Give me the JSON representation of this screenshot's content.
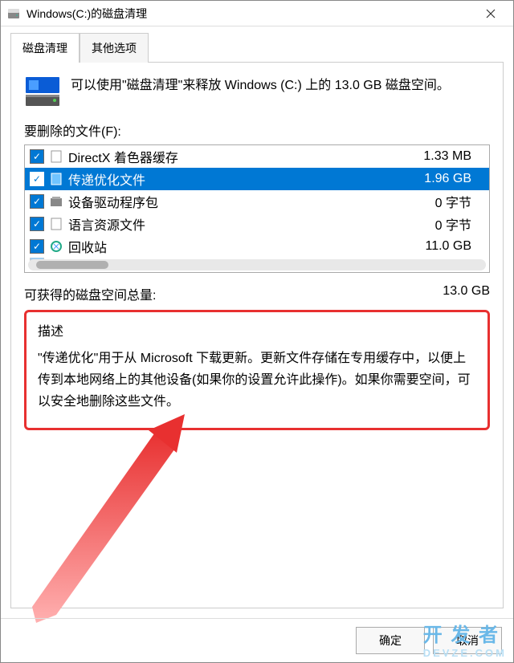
{
  "titlebar": {
    "title": "Windows(C:)的磁盘清理"
  },
  "tabs": {
    "cleanup": "磁盘清理",
    "other": "其他选项"
  },
  "intro": "可以使用\"磁盘清理\"来释放 Windows (C:) 上的 13.0 GB 磁盘空间。",
  "list_label": "要删除的文件(F):",
  "files": [
    {
      "name": "DirectX 着色器缓存",
      "size": "1.33 MB",
      "checked": true,
      "selected": false,
      "icon": "file"
    },
    {
      "name": "传递优化文件",
      "size": "1.96 GB",
      "checked": true,
      "selected": true,
      "icon": "file-blue"
    },
    {
      "name": "设备驱动程序包",
      "size": "0 字节",
      "checked": true,
      "selected": false,
      "icon": "package"
    },
    {
      "name": "语言资源文件",
      "size": "0 字节",
      "checked": true,
      "selected": false,
      "icon": "file"
    },
    {
      "name": "回收站",
      "size": "11.0 GB",
      "checked": true,
      "selected": false,
      "icon": "recycle"
    }
  ],
  "total": {
    "label": "可获得的磁盘空间总量:",
    "value": "13.0 GB"
  },
  "description": {
    "title": "描述",
    "text": "\"传递优化\"用于从 Microsoft 下载更新。更新文件存储在专用缓存中，以便上传到本地网络上的其他设备(如果你的设置允许此操作)。如果你需要空间，可以安全地删除这些文件。"
  },
  "buttons": {
    "ok": "确定",
    "cancel": "取消"
  },
  "watermark": {
    "top": "开 发 者",
    "bottom": "DEVZE.COM"
  }
}
